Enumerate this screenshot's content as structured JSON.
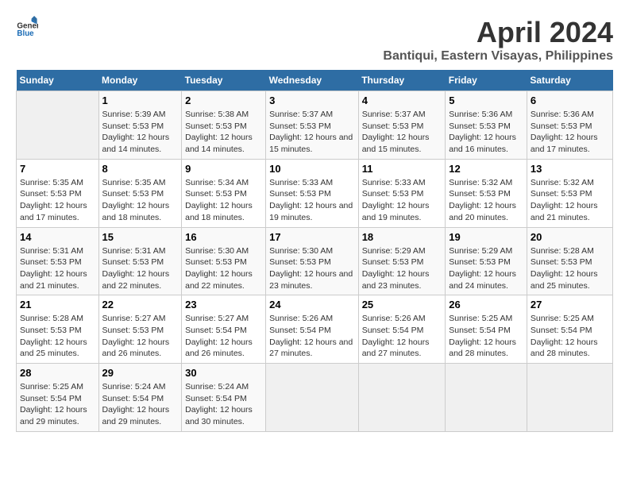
{
  "logo": {
    "general": "General",
    "blue": "Blue"
  },
  "title": "April 2024",
  "subtitle": "Bantiqui, Eastern Visayas, Philippines",
  "headers": [
    "Sunday",
    "Monday",
    "Tuesday",
    "Wednesday",
    "Thursday",
    "Friday",
    "Saturday"
  ],
  "weeks": [
    [
      {
        "day": "",
        "sunrise": "",
        "sunset": "",
        "daylight": "",
        "empty": true
      },
      {
        "day": "1",
        "sunrise": "Sunrise: 5:39 AM",
        "sunset": "Sunset: 5:53 PM",
        "daylight": "Daylight: 12 hours and 14 minutes.",
        "empty": false
      },
      {
        "day": "2",
        "sunrise": "Sunrise: 5:38 AM",
        "sunset": "Sunset: 5:53 PM",
        "daylight": "Daylight: 12 hours and 14 minutes.",
        "empty": false
      },
      {
        "day": "3",
        "sunrise": "Sunrise: 5:37 AM",
        "sunset": "Sunset: 5:53 PM",
        "daylight": "Daylight: 12 hours and 15 minutes.",
        "empty": false
      },
      {
        "day": "4",
        "sunrise": "Sunrise: 5:37 AM",
        "sunset": "Sunset: 5:53 PM",
        "daylight": "Daylight: 12 hours and 15 minutes.",
        "empty": false
      },
      {
        "day": "5",
        "sunrise": "Sunrise: 5:36 AM",
        "sunset": "Sunset: 5:53 PM",
        "daylight": "Daylight: 12 hours and 16 minutes.",
        "empty": false
      },
      {
        "day": "6",
        "sunrise": "Sunrise: 5:36 AM",
        "sunset": "Sunset: 5:53 PM",
        "daylight": "Daylight: 12 hours and 17 minutes.",
        "empty": false
      }
    ],
    [
      {
        "day": "7",
        "sunrise": "Sunrise: 5:35 AM",
        "sunset": "Sunset: 5:53 PM",
        "daylight": "Daylight: 12 hours and 17 minutes.",
        "empty": false
      },
      {
        "day": "8",
        "sunrise": "Sunrise: 5:35 AM",
        "sunset": "Sunset: 5:53 PM",
        "daylight": "Daylight: 12 hours and 18 minutes.",
        "empty": false
      },
      {
        "day": "9",
        "sunrise": "Sunrise: 5:34 AM",
        "sunset": "Sunset: 5:53 PM",
        "daylight": "Daylight: 12 hours and 18 minutes.",
        "empty": false
      },
      {
        "day": "10",
        "sunrise": "Sunrise: 5:33 AM",
        "sunset": "Sunset: 5:53 PM",
        "daylight": "Daylight: 12 hours and 19 minutes.",
        "empty": false
      },
      {
        "day": "11",
        "sunrise": "Sunrise: 5:33 AM",
        "sunset": "Sunset: 5:53 PM",
        "daylight": "Daylight: 12 hours and 19 minutes.",
        "empty": false
      },
      {
        "day": "12",
        "sunrise": "Sunrise: 5:32 AM",
        "sunset": "Sunset: 5:53 PM",
        "daylight": "Daylight: 12 hours and 20 minutes.",
        "empty": false
      },
      {
        "day": "13",
        "sunrise": "Sunrise: 5:32 AM",
        "sunset": "Sunset: 5:53 PM",
        "daylight": "Daylight: 12 hours and 21 minutes.",
        "empty": false
      }
    ],
    [
      {
        "day": "14",
        "sunrise": "Sunrise: 5:31 AM",
        "sunset": "Sunset: 5:53 PM",
        "daylight": "Daylight: 12 hours and 21 minutes.",
        "empty": false
      },
      {
        "day": "15",
        "sunrise": "Sunrise: 5:31 AM",
        "sunset": "Sunset: 5:53 PM",
        "daylight": "Daylight: 12 hours and 22 minutes.",
        "empty": false
      },
      {
        "day": "16",
        "sunrise": "Sunrise: 5:30 AM",
        "sunset": "Sunset: 5:53 PM",
        "daylight": "Daylight: 12 hours and 22 minutes.",
        "empty": false
      },
      {
        "day": "17",
        "sunrise": "Sunrise: 5:30 AM",
        "sunset": "Sunset: 5:53 PM",
        "daylight": "Daylight: 12 hours and 23 minutes.",
        "empty": false
      },
      {
        "day": "18",
        "sunrise": "Sunrise: 5:29 AM",
        "sunset": "Sunset: 5:53 PM",
        "daylight": "Daylight: 12 hours and 23 minutes.",
        "empty": false
      },
      {
        "day": "19",
        "sunrise": "Sunrise: 5:29 AM",
        "sunset": "Sunset: 5:53 PM",
        "daylight": "Daylight: 12 hours and 24 minutes.",
        "empty": false
      },
      {
        "day": "20",
        "sunrise": "Sunrise: 5:28 AM",
        "sunset": "Sunset: 5:53 PM",
        "daylight": "Daylight: 12 hours and 25 minutes.",
        "empty": false
      }
    ],
    [
      {
        "day": "21",
        "sunrise": "Sunrise: 5:28 AM",
        "sunset": "Sunset: 5:53 PM",
        "daylight": "Daylight: 12 hours and 25 minutes.",
        "empty": false
      },
      {
        "day": "22",
        "sunrise": "Sunrise: 5:27 AM",
        "sunset": "Sunset: 5:53 PM",
        "daylight": "Daylight: 12 hours and 26 minutes.",
        "empty": false
      },
      {
        "day": "23",
        "sunrise": "Sunrise: 5:27 AM",
        "sunset": "Sunset: 5:54 PM",
        "daylight": "Daylight: 12 hours and 26 minutes.",
        "empty": false
      },
      {
        "day": "24",
        "sunrise": "Sunrise: 5:26 AM",
        "sunset": "Sunset: 5:54 PM",
        "daylight": "Daylight: 12 hours and 27 minutes.",
        "empty": false
      },
      {
        "day": "25",
        "sunrise": "Sunrise: 5:26 AM",
        "sunset": "Sunset: 5:54 PM",
        "daylight": "Daylight: 12 hours and 27 minutes.",
        "empty": false
      },
      {
        "day": "26",
        "sunrise": "Sunrise: 5:25 AM",
        "sunset": "Sunset: 5:54 PM",
        "daylight": "Daylight: 12 hours and 28 minutes.",
        "empty": false
      },
      {
        "day": "27",
        "sunrise": "Sunrise: 5:25 AM",
        "sunset": "Sunset: 5:54 PM",
        "daylight": "Daylight: 12 hours and 28 minutes.",
        "empty": false
      }
    ],
    [
      {
        "day": "28",
        "sunrise": "Sunrise: 5:25 AM",
        "sunset": "Sunset: 5:54 PM",
        "daylight": "Daylight: 12 hours and 29 minutes.",
        "empty": false
      },
      {
        "day": "29",
        "sunrise": "Sunrise: 5:24 AM",
        "sunset": "Sunset: 5:54 PM",
        "daylight": "Daylight: 12 hours and 29 minutes.",
        "empty": false
      },
      {
        "day": "30",
        "sunrise": "Sunrise: 5:24 AM",
        "sunset": "Sunset: 5:54 PM",
        "daylight": "Daylight: 12 hours and 30 minutes.",
        "empty": false
      },
      {
        "day": "",
        "sunrise": "",
        "sunset": "",
        "daylight": "",
        "empty": true
      },
      {
        "day": "",
        "sunrise": "",
        "sunset": "",
        "daylight": "",
        "empty": true
      },
      {
        "day": "",
        "sunrise": "",
        "sunset": "",
        "daylight": "",
        "empty": true
      },
      {
        "day": "",
        "sunrise": "",
        "sunset": "",
        "daylight": "",
        "empty": true
      }
    ]
  ]
}
